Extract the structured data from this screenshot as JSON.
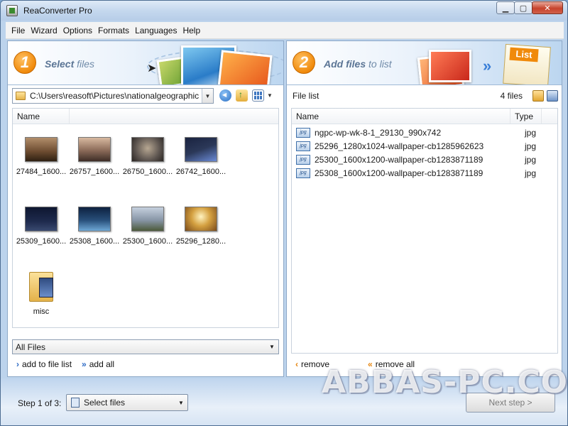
{
  "window": {
    "title": "ReaConverter Pro",
    "minimize": "▁",
    "maximize": "▢",
    "close": "✕"
  },
  "menu": [
    "File",
    "Wizard",
    "Options",
    "Formats",
    "Languages",
    "Help"
  ],
  "left_panel": {
    "step_number": "1",
    "title_bold": "Select",
    "title_rest": "files",
    "path": "C:\\Users\\reasoft\\Pictures\\nationalgeographic",
    "column_name": "Name",
    "thumbnails": [
      {
        "label": "27484_1600...",
        "color": "#6b4a2f"
      },
      {
        "label": "26757_1600...",
        "color": "#8a6a58"
      },
      {
        "label": "26750_1600...",
        "color": "#5d5550"
      },
      {
        "label": "26742_1600...",
        "color": "#2b3858"
      },
      {
        "label": "25309_1600...",
        "color": "#1e2a4d"
      },
      {
        "label": "25308_1600...",
        "color": "#284f7a"
      },
      {
        "label": "25300_1600...",
        "color": "#8795a6"
      },
      {
        "label": "25296_1280...",
        "color": "#d4a040"
      }
    ],
    "folder_label": "misc",
    "filter_value": "All Files",
    "action_add": "add to file list",
    "action_add_all": "add all"
  },
  "right_panel": {
    "step_number": "2",
    "title_bold": "Add files",
    "title_rest": "to list",
    "list_title": "File list",
    "file_count": "4 files",
    "col_name": "Name",
    "col_type": "Type",
    "files": [
      {
        "name": "ngpc-wp-wk-8-1_29130_990x742",
        "type": "jpg",
        "icon": "jpg"
      },
      {
        "name": "25296_1280x1024-wallpaper-cb1285962623",
        "type": "jpg",
        "icon": "jpg"
      },
      {
        "name": "25300_1600x1200-wallpaper-cb1283871189",
        "type": "jpg",
        "icon": "jpg"
      },
      {
        "name": "25308_1600x1200-wallpaper-cb1283871189",
        "type": "jpg",
        "icon": "jpg"
      }
    ],
    "action_remove": "remove",
    "action_remove_all": "remove all"
  },
  "bottom": {
    "step_label": "Step 1 of 3:",
    "step_value": "Select files",
    "next_label": "Next step >",
    "watermark": "ABBAS-PC.COM"
  }
}
